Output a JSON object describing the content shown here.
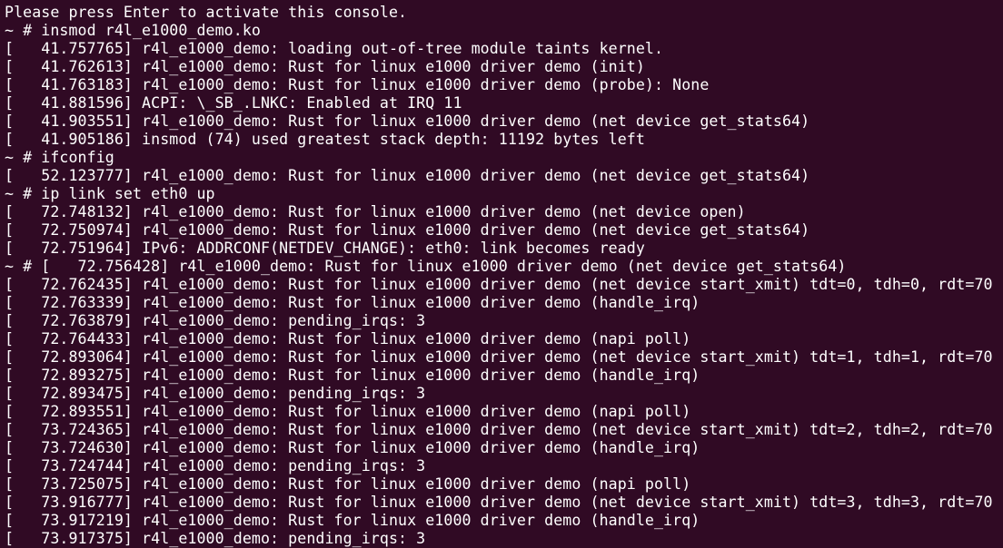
{
  "terminal": {
    "background": "#300a24",
    "foreground": "#ffffff",
    "lines": [
      "Please press Enter to activate this console.",
      "~ # insmod r4l_e1000_demo.ko",
      "[   41.757765] r4l_e1000_demo: loading out-of-tree module taints kernel.",
      "[   41.762613] r4l_e1000_demo: Rust for linux e1000 driver demo (init)",
      "[   41.763183] r4l_e1000_demo: Rust for linux e1000 driver demo (probe): None",
      "[   41.881596] ACPI: \\_SB_.LNKC: Enabled at IRQ 11",
      "[   41.903551] r4l_e1000_demo: Rust for linux e1000 driver demo (net device get_stats64)",
      "[   41.905186] insmod (74) used greatest stack depth: 11192 bytes left",
      "~ # ifconfig",
      "[   52.123777] r4l_e1000_demo: Rust for linux e1000 driver demo (net device get_stats64)",
      "~ # ip link set eth0 up",
      "[   72.748132] r4l_e1000_demo: Rust for linux e1000 driver demo (net device open)",
      "[   72.750974] r4l_e1000_demo: Rust for linux e1000 driver demo (net device get_stats64)",
      "[   72.751964] IPv6: ADDRCONF(NETDEV_CHANGE): eth0: link becomes ready",
      "~ # [   72.756428] r4l_e1000_demo: Rust for linux e1000 driver demo (net device get_stats64)",
      "[   72.762435] r4l_e1000_demo: Rust for linux e1000 driver demo (net device start_xmit) tdt=0, tdh=0, rdt=70",
      "[   72.763339] r4l_e1000_demo: Rust for linux e1000 driver demo (handle_irq)",
      "[   72.763879] r4l_e1000_demo: pending_irqs: 3",
      "[   72.764433] r4l_e1000_demo: Rust for linux e1000 driver demo (napi poll)",
      "[   72.893064] r4l_e1000_demo: Rust for linux e1000 driver demo (net device start_xmit) tdt=1, tdh=1, rdt=70",
      "[   72.893275] r4l_e1000_demo: Rust for linux e1000 driver demo (handle_irq)",
      "[   72.893475] r4l_e1000_demo: pending_irqs: 3",
      "[   72.893551] r4l_e1000_demo: Rust for linux e1000 driver demo (napi poll)",
      "[   73.724365] r4l_e1000_demo: Rust for linux e1000 driver demo (net device start_xmit) tdt=2, tdh=2, rdt=70",
      "[   73.724630] r4l_e1000_demo: Rust for linux e1000 driver demo (handle_irq)",
      "[   73.724744] r4l_e1000_demo: pending_irqs: 3",
      "[   73.725075] r4l_e1000_demo: Rust for linux e1000 driver demo (napi poll)",
      "[   73.916777] r4l_e1000_demo: Rust for linux e1000 driver demo (net device start_xmit) tdt=3, tdh=3, rdt=70",
      "[   73.917219] r4l_e1000_demo: Rust for linux e1000 driver demo (handle_irq)",
      "[   73.917375] r4l_e1000_demo: pending_irqs: 3"
    ]
  }
}
